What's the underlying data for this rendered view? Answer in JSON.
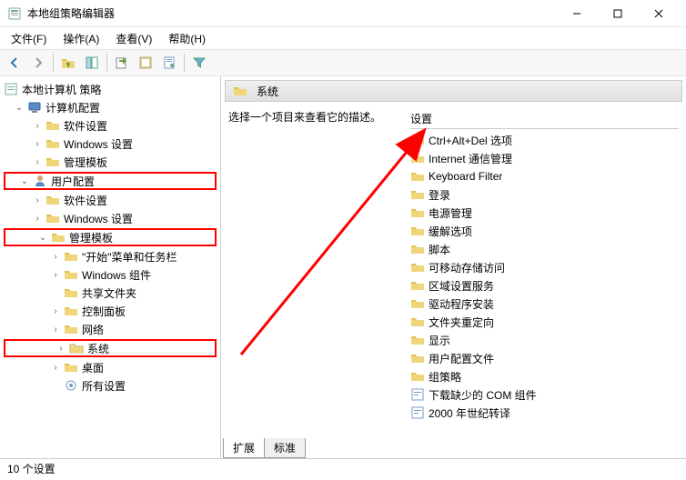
{
  "window": {
    "title": "本地组策略编辑器"
  },
  "menu": {
    "file": "文件(F)",
    "action": "操作(A)",
    "view": "查看(V)",
    "help": "帮助(H)"
  },
  "tree": {
    "root": "本地计算机 策略",
    "computer_config": "计算机配置",
    "cc_software": "软件设置",
    "cc_windows": "Windows 设置",
    "cc_templates": "管理模板",
    "user_config": "用户配置",
    "uc_software": "软件设置",
    "uc_windows": "Windows 设置",
    "uc_templates": "管理模板",
    "start_menu": "\"开始\"菜单和任务栏",
    "win_components": "Windows 组件",
    "shared_folders": "共享文件夹",
    "control_panel": "控制面板",
    "network": "网络",
    "system": "系统",
    "desktop": "桌面",
    "all_settings": "所有设置"
  },
  "right": {
    "header": "系统",
    "desc": "选择一个项目来查看它的描述。",
    "settings_header": "设置",
    "items": [
      {
        "type": "folder",
        "label": "Ctrl+Alt+Del 选项"
      },
      {
        "type": "folder",
        "label": "Internet 通信管理"
      },
      {
        "type": "folder",
        "label": "Keyboard Filter"
      },
      {
        "type": "folder",
        "label": "登录"
      },
      {
        "type": "folder",
        "label": "电源管理"
      },
      {
        "type": "folder",
        "label": "缓解选项"
      },
      {
        "type": "folder",
        "label": "脚本"
      },
      {
        "type": "folder",
        "label": "可移动存储访问"
      },
      {
        "type": "folder",
        "label": "区域设置服务"
      },
      {
        "type": "folder",
        "label": "驱动程序安装"
      },
      {
        "type": "folder",
        "label": "文件夹重定向"
      },
      {
        "type": "folder",
        "label": "显示"
      },
      {
        "type": "folder",
        "label": "用户配置文件"
      },
      {
        "type": "folder",
        "label": "组策略"
      },
      {
        "type": "setting",
        "label": "下载缺少的 COM 组件"
      },
      {
        "type": "setting",
        "label": "2000 年世纪转译"
      }
    ]
  },
  "tabs": {
    "extended": "扩展",
    "standard": "标准"
  },
  "status": "10 个设置"
}
